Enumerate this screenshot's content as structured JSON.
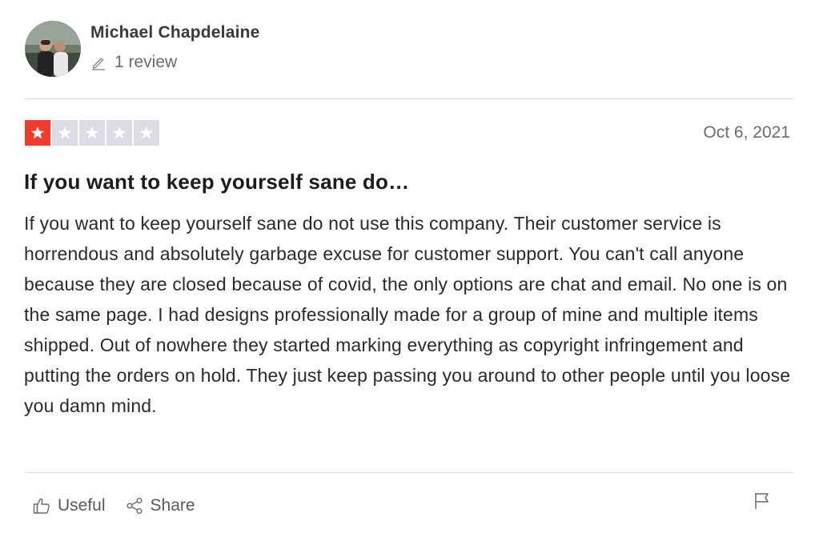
{
  "reviewer": {
    "name": "Michael Chapdelaine",
    "review_count": "1 review"
  },
  "review": {
    "rating": 1,
    "max_rating": 5,
    "date": "Oct 6, 2021",
    "title": "If you want to keep yourself sane do…",
    "body": "If you want to keep yourself sane do not use this company. Their customer service is horrendous and absolutely garbage excuse for customer support. You can't call anyone because they are closed because of covid, the only options are chat and email. No one is on the same page. I had designs professionally made for a group of mine and multiple items shipped. Out of nowhere they started marking everything as copyright infringement and putting the orders on hold. They just keep passing you around to other people until you loose you damn mind."
  },
  "actions": {
    "useful_label": "Useful",
    "share_label": "Share"
  },
  "icons": {
    "review_count": "pencil-icon",
    "useful": "thumbs-up-icon",
    "share": "share-icon",
    "flag": "flag-icon"
  },
  "colors": {
    "star_filled": "#ee3d2c",
    "star_empty": "#dcdce6",
    "divider": "#dcdce3"
  }
}
